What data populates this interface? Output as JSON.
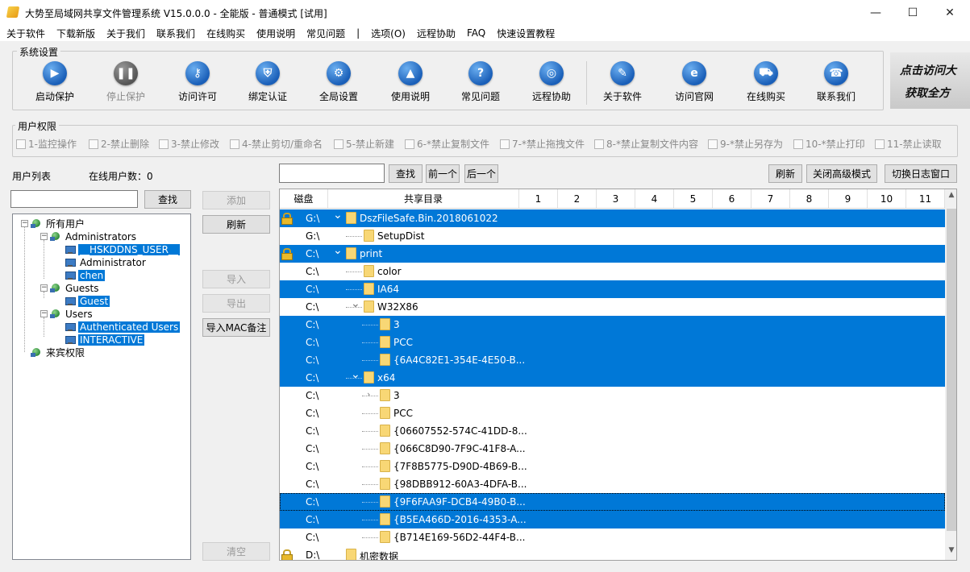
{
  "window": {
    "title": "大势至局域网共享文件管理系统 V15.0.0.0 - 全能版 - 普通模式 [试用]",
    "minimize": "—",
    "maximize": "☐",
    "close": "✕"
  },
  "menu": [
    "关于软件",
    "下载新版",
    "关于我们",
    "联系我们",
    "在线购买",
    "使用说明",
    "常见问题",
    "|",
    "选项(O)",
    "远程协助",
    "FAQ",
    "快速设置教程"
  ],
  "system_settings": {
    "title": "系统设置",
    "buttons": [
      {
        "label": "启动保护",
        "icon": "play-icon",
        "glyph": "▶",
        "disabled": false
      },
      {
        "label": "停止保护",
        "icon": "pause-icon",
        "glyph": "❚❚",
        "disabled": true
      },
      {
        "label": "访问许可",
        "icon": "key-icon",
        "glyph": "⚷",
        "disabled": false
      },
      {
        "label": "绑定认证",
        "icon": "shield-icon",
        "glyph": "⛨",
        "disabled": false
      },
      {
        "label": "全局设置",
        "icon": "gear-icon",
        "glyph": "⚙",
        "disabled": false
      },
      {
        "label": "使用说明",
        "icon": "graduation-cap-icon",
        "glyph": "▲",
        "disabled": false
      },
      {
        "label": "常见问题",
        "icon": "question-icon",
        "glyph": "?",
        "disabled": false
      },
      {
        "label": "远程协助",
        "icon": "globe-icon",
        "glyph": "◎",
        "disabled": false
      },
      {
        "label": "关于软件",
        "icon": "document-icon",
        "glyph": "✎",
        "disabled": false
      },
      {
        "label": "访问官网",
        "icon": "ie-icon",
        "glyph": "e",
        "disabled": false
      },
      {
        "label": "在线购买",
        "icon": "cart-icon",
        "glyph": "⛟",
        "disabled": false
      },
      {
        "label": "联系我们",
        "icon": "phone-icon",
        "glyph": "☎",
        "disabled": false
      }
    ]
  },
  "banner": {
    "line1": "点击访问大",
    "line2": "获取全方"
  },
  "user_permissions": {
    "title": "用户权限",
    "items": [
      "1-监控操作",
      "2-禁止删除",
      "3-禁止修改",
      "4-禁止剪切/重命名",
      "5-禁止新建",
      "6-*禁止复制文件",
      "7-*禁止拖拽文件",
      "8-*禁止复制文件内容",
      "9-*禁止另存为",
      "10-*禁止打印",
      "11-禁止读取"
    ]
  },
  "user_list": {
    "label": "用户列表",
    "online_label": "在线用户数：0",
    "search_button": "查找",
    "tree": [
      {
        "label": "所有用户",
        "icon": "network-icon",
        "level": 0,
        "selected": false
      },
      {
        "label": "Administrators",
        "icon": "network-icon",
        "level": 1,
        "selected": false
      },
      {
        "label": "__HSKDDNS_USER__",
        "icon": "computer-icon",
        "level": 2,
        "selected": true
      },
      {
        "label": "Administrator",
        "icon": "computer-icon",
        "level": 2,
        "selected": false
      },
      {
        "label": "chen",
        "icon": "computer-icon",
        "level": 2,
        "selected": true
      },
      {
        "label": "Guests",
        "icon": "network-icon",
        "level": 1,
        "selected": false
      },
      {
        "label": "Guest",
        "icon": "computer-icon",
        "level": 2,
        "selected": true
      },
      {
        "label": "Users",
        "icon": "network-icon",
        "level": 1,
        "selected": false
      },
      {
        "label": "Authenticated Users",
        "icon": "computer-icon",
        "level": 2,
        "selected": true
      },
      {
        "label": "INTERACTIVE",
        "icon": "computer-icon",
        "level": 2,
        "selected": true
      },
      {
        "label": "来宾权限",
        "icon": "network-icon",
        "level": 0,
        "selected": false
      }
    ]
  },
  "side_buttons": {
    "add": "添加",
    "refresh": "刷新",
    "import": "导入",
    "export": "导出",
    "import_mac": "导入MAC备注",
    "clear": "清空"
  },
  "share_toolbar": {
    "search": "查找",
    "prev": "前一个",
    "next": "后一个",
    "refresh": "刷新",
    "close_advanced": "关闭高级模式",
    "switch_log": "切换日志窗口"
  },
  "grid": {
    "columns": [
      "磁盘",
      "共享目录",
      "1",
      "2",
      "3",
      "4",
      "5",
      "6",
      "7",
      "8",
      "9",
      "10",
      "11"
    ],
    "rows": [
      {
        "disk": "G:\\",
        "name": "DszFileSafe.Bin.2018061022",
        "depth": 0,
        "lock": true,
        "selected": true,
        "expander": "v"
      },
      {
        "disk": "G:\\",
        "name": "SetupDist",
        "depth": 1,
        "lock": false,
        "selected": false,
        "expander": ""
      },
      {
        "disk": "C:\\",
        "name": "print",
        "depth": 0,
        "lock": true,
        "selected": true,
        "expander": "v"
      },
      {
        "disk": "C:\\",
        "name": "color",
        "depth": 1,
        "lock": false,
        "selected": false,
        "expander": ""
      },
      {
        "disk": "C:\\",
        "name": "IA64",
        "depth": 1,
        "lock": false,
        "selected": true,
        "expander": ""
      },
      {
        "disk": "C:\\",
        "name": "W32X86",
        "depth": 1,
        "lock": false,
        "selected": false,
        "expander": "v"
      },
      {
        "disk": "C:\\",
        "name": "3",
        "depth": 2,
        "lock": false,
        "selected": true,
        "expander": ""
      },
      {
        "disk": "C:\\",
        "name": "PCC",
        "depth": 2,
        "lock": false,
        "selected": true,
        "expander": ""
      },
      {
        "disk": "C:\\",
        "name": "{6A4C82E1-354E-4E50-B...",
        "depth": 2,
        "lock": false,
        "selected": true,
        "expander": ""
      },
      {
        "disk": "C:\\",
        "name": "x64",
        "depth": 1,
        "lock": false,
        "selected": true,
        "expander": "v"
      },
      {
        "disk": "C:\\",
        "name": "3",
        "depth": 2,
        "lock": false,
        "selected": false,
        "expander": ">"
      },
      {
        "disk": "C:\\",
        "name": "PCC",
        "depth": 2,
        "lock": false,
        "selected": false,
        "expander": ""
      },
      {
        "disk": "C:\\",
        "name": "{06607552-574C-41DD-8...",
        "depth": 2,
        "lock": false,
        "selected": false,
        "expander": ""
      },
      {
        "disk": "C:\\",
        "name": "{066C8D90-7F9C-41F8-A...",
        "depth": 2,
        "lock": false,
        "selected": false,
        "expander": ""
      },
      {
        "disk": "C:\\",
        "name": "{7F8B5775-D90D-4B69-B...",
        "depth": 2,
        "lock": false,
        "selected": false,
        "expander": ""
      },
      {
        "disk": "C:\\",
        "name": "{98DBB912-60A3-4DFA-B...",
        "depth": 2,
        "lock": false,
        "selected": false,
        "expander": ""
      },
      {
        "disk": "C:\\",
        "name": "{9F6FAA9F-DCB4-49B0-B...",
        "depth": 2,
        "lock": false,
        "selected": true,
        "expander": "",
        "focus": true
      },
      {
        "disk": "C:\\",
        "name": "{B5EA466D-2016-4353-A...",
        "depth": 2,
        "lock": false,
        "selected": true,
        "expander": ""
      },
      {
        "disk": "C:\\",
        "name": "{B714E169-56D2-44F4-B...",
        "depth": 2,
        "lock": false,
        "selected": false,
        "expander": ""
      },
      {
        "disk": "D:\\",
        "name": "机密数据",
        "depth": 0,
        "lock": true,
        "selected": false,
        "expander": ""
      }
    ]
  },
  "colors": {
    "selection": "#0078d7",
    "toolbar_icon": "#1a5fb8",
    "folder": "#f8d775"
  }
}
